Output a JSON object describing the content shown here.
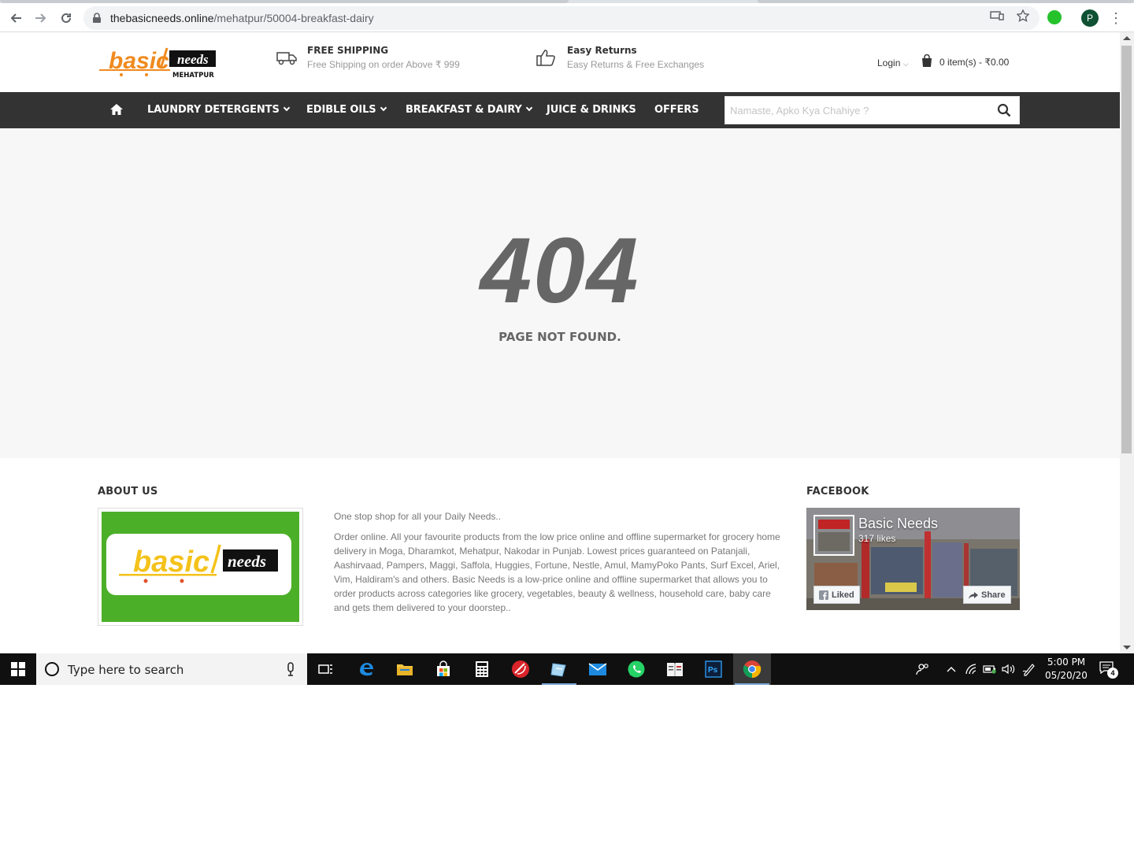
{
  "browser": {
    "url_host": "thebasicneeds.online",
    "url_path": "/mehatpur/50004-breakfast-dairy",
    "profile_initial": "P"
  },
  "header": {
    "logo_main": "basic",
    "logo_tag": "needs",
    "logo_location": "MEHATPUR",
    "shipping_title": "FREE SHIPPING",
    "shipping_sub": "Free Shipping on order Above ₹ 999",
    "returns_title": "Easy Returns",
    "returns_sub": "Easy Returns & Free Exchanges",
    "login_label": "Login",
    "cart_text": "0 item(s) - ₹0.00"
  },
  "nav": {
    "items": [
      {
        "label": "LAUNDRY DETERGENTS",
        "dropdown": true
      },
      {
        "label": "EDIBLE OILS",
        "dropdown": true
      },
      {
        "label": "BREAKFAST & DAIRY",
        "dropdown": true
      },
      {
        "label": "JUICE & DRINKS",
        "dropdown": false
      },
      {
        "label": "OFFERS",
        "dropdown": false
      }
    ],
    "search_placeholder": "Namaste, Apko Kya Chahiye ?"
  },
  "error": {
    "code": "404",
    "message": "PAGE NOT FOUND."
  },
  "footer": {
    "about_title": "ABOUT US",
    "about_logo_main": "basic",
    "about_logo_tag": "needs",
    "about_p1": "One stop shop for all your Daily Needs..",
    "about_p2": "Order online. All your favourite products from the low price online and offline supermarket for grocery home delivery in Moga, Dharamkot, Mehatpur, Nakodar in Punjab. Lowest prices guaranteed on Patanjali, Aashirvaad, Pampers, Maggi, Saffola, Huggies, Fortune, Nestle, Amul, MamyPoko Pants, Surf Excel, Ariel, Vim, Haldiram's and others. Basic Needs is a low-price online and offline supermarket that allows you to order products across categories like grocery, vegetables, beauty & wellness, household care, baby care and gets them delivered to your doorstep..",
    "facebook_title": "FACEBOOK",
    "fb_page_name": "Basic Needs",
    "fb_likes": "317 likes",
    "fb_liked_label": "Liked",
    "fb_share_label": "Share"
  },
  "taskbar": {
    "search_placeholder": "Type here to search",
    "time": "5:00 PM",
    "date": "05/20/20",
    "notification_count": "4"
  },
  "colors": {
    "brand_orange": "#f08a1e",
    "nav_bg": "#333333",
    "error_bg": "#f7f7f7",
    "error_text": "#666666",
    "about_green": "#4caf28"
  }
}
